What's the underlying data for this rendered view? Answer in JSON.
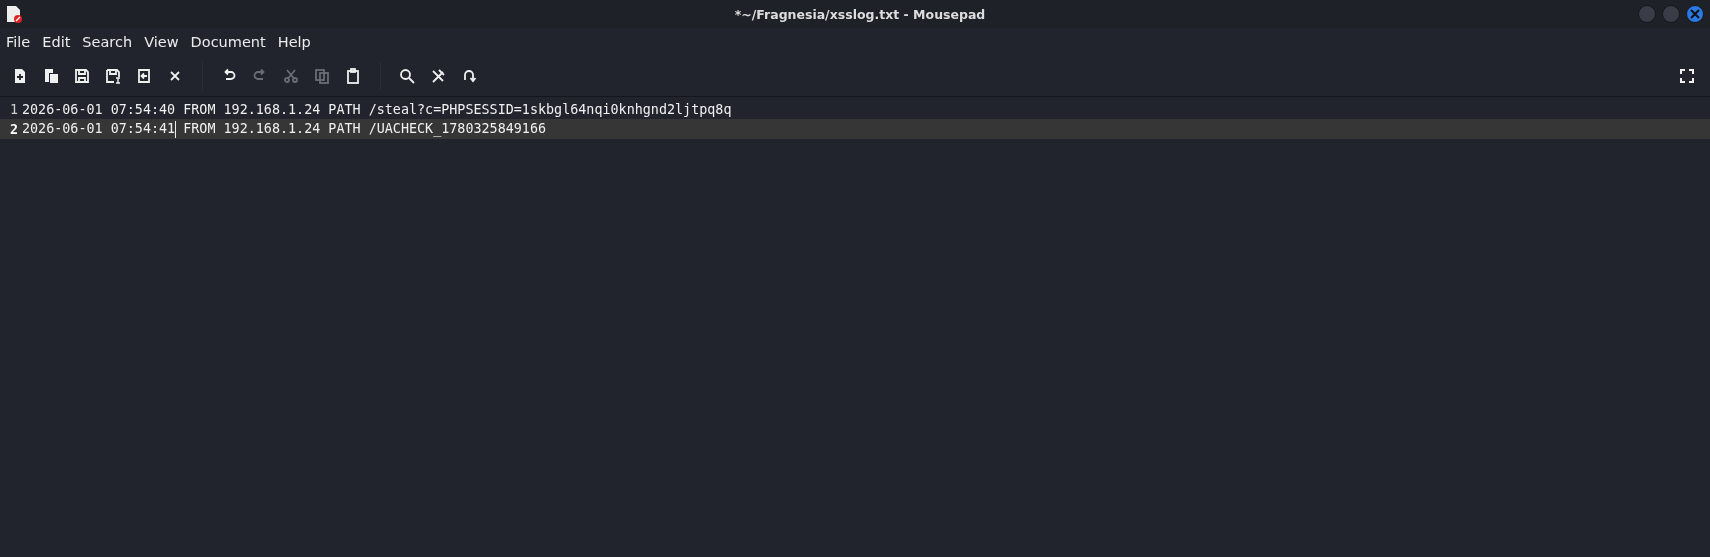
{
  "window": {
    "title": "*~/Fragnesia/xsslog.txt - Mousepad"
  },
  "menu": [
    "File",
    "Edit",
    "Search",
    "View",
    "Document",
    "Help"
  ],
  "toolbar_groups": [
    [
      {
        "kind": "new",
        "disabled": false
      },
      {
        "kind": "new-window",
        "disabled": false
      },
      {
        "kind": "save",
        "disabled": false
      },
      {
        "kind": "save-as",
        "disabled": false
      },
      {
        "kind": "reload",
        "disabled": false
      },
      {
        "kind": "close",
        "disabled": false
      }
    ],
    [
      {
        "kind": "undo",
        "disabled": false
      },
      {
        "kind": "redo",
        "disabled": true
      },
      {
        "kind": "cut",
        "disabled": true
      },
      {
        "kind": "copy",
        "disabled": true
      },
      {
        "kind": "paste",
        "disabled": false
      }
    ],
    [
      {
        "kind": "find",
        "disabled": false
      },
      {
        "kind": "replace",
        "disabled": false
      },
      {
        "kind": "goto",
        "disabled": false
      }
    ]
  ],
  "lines": [
    {
      "number": "1",
      "before_cursor": "2026-06-01 07:54:40 FROM 192.168.1.24 PATH /steal?c=PHPSESSID=1skbgl64nqi0knhgnd2ljtpq8q",
      "current": false
    },
    {
      "number": "2",
      "before_cursor": "2026-06-01 07:54:41",
      "after_cursor": " FROM 192.168.1.24 PATH /UACHECK_1780325849166",
      "current": true
    }
  ]
}
